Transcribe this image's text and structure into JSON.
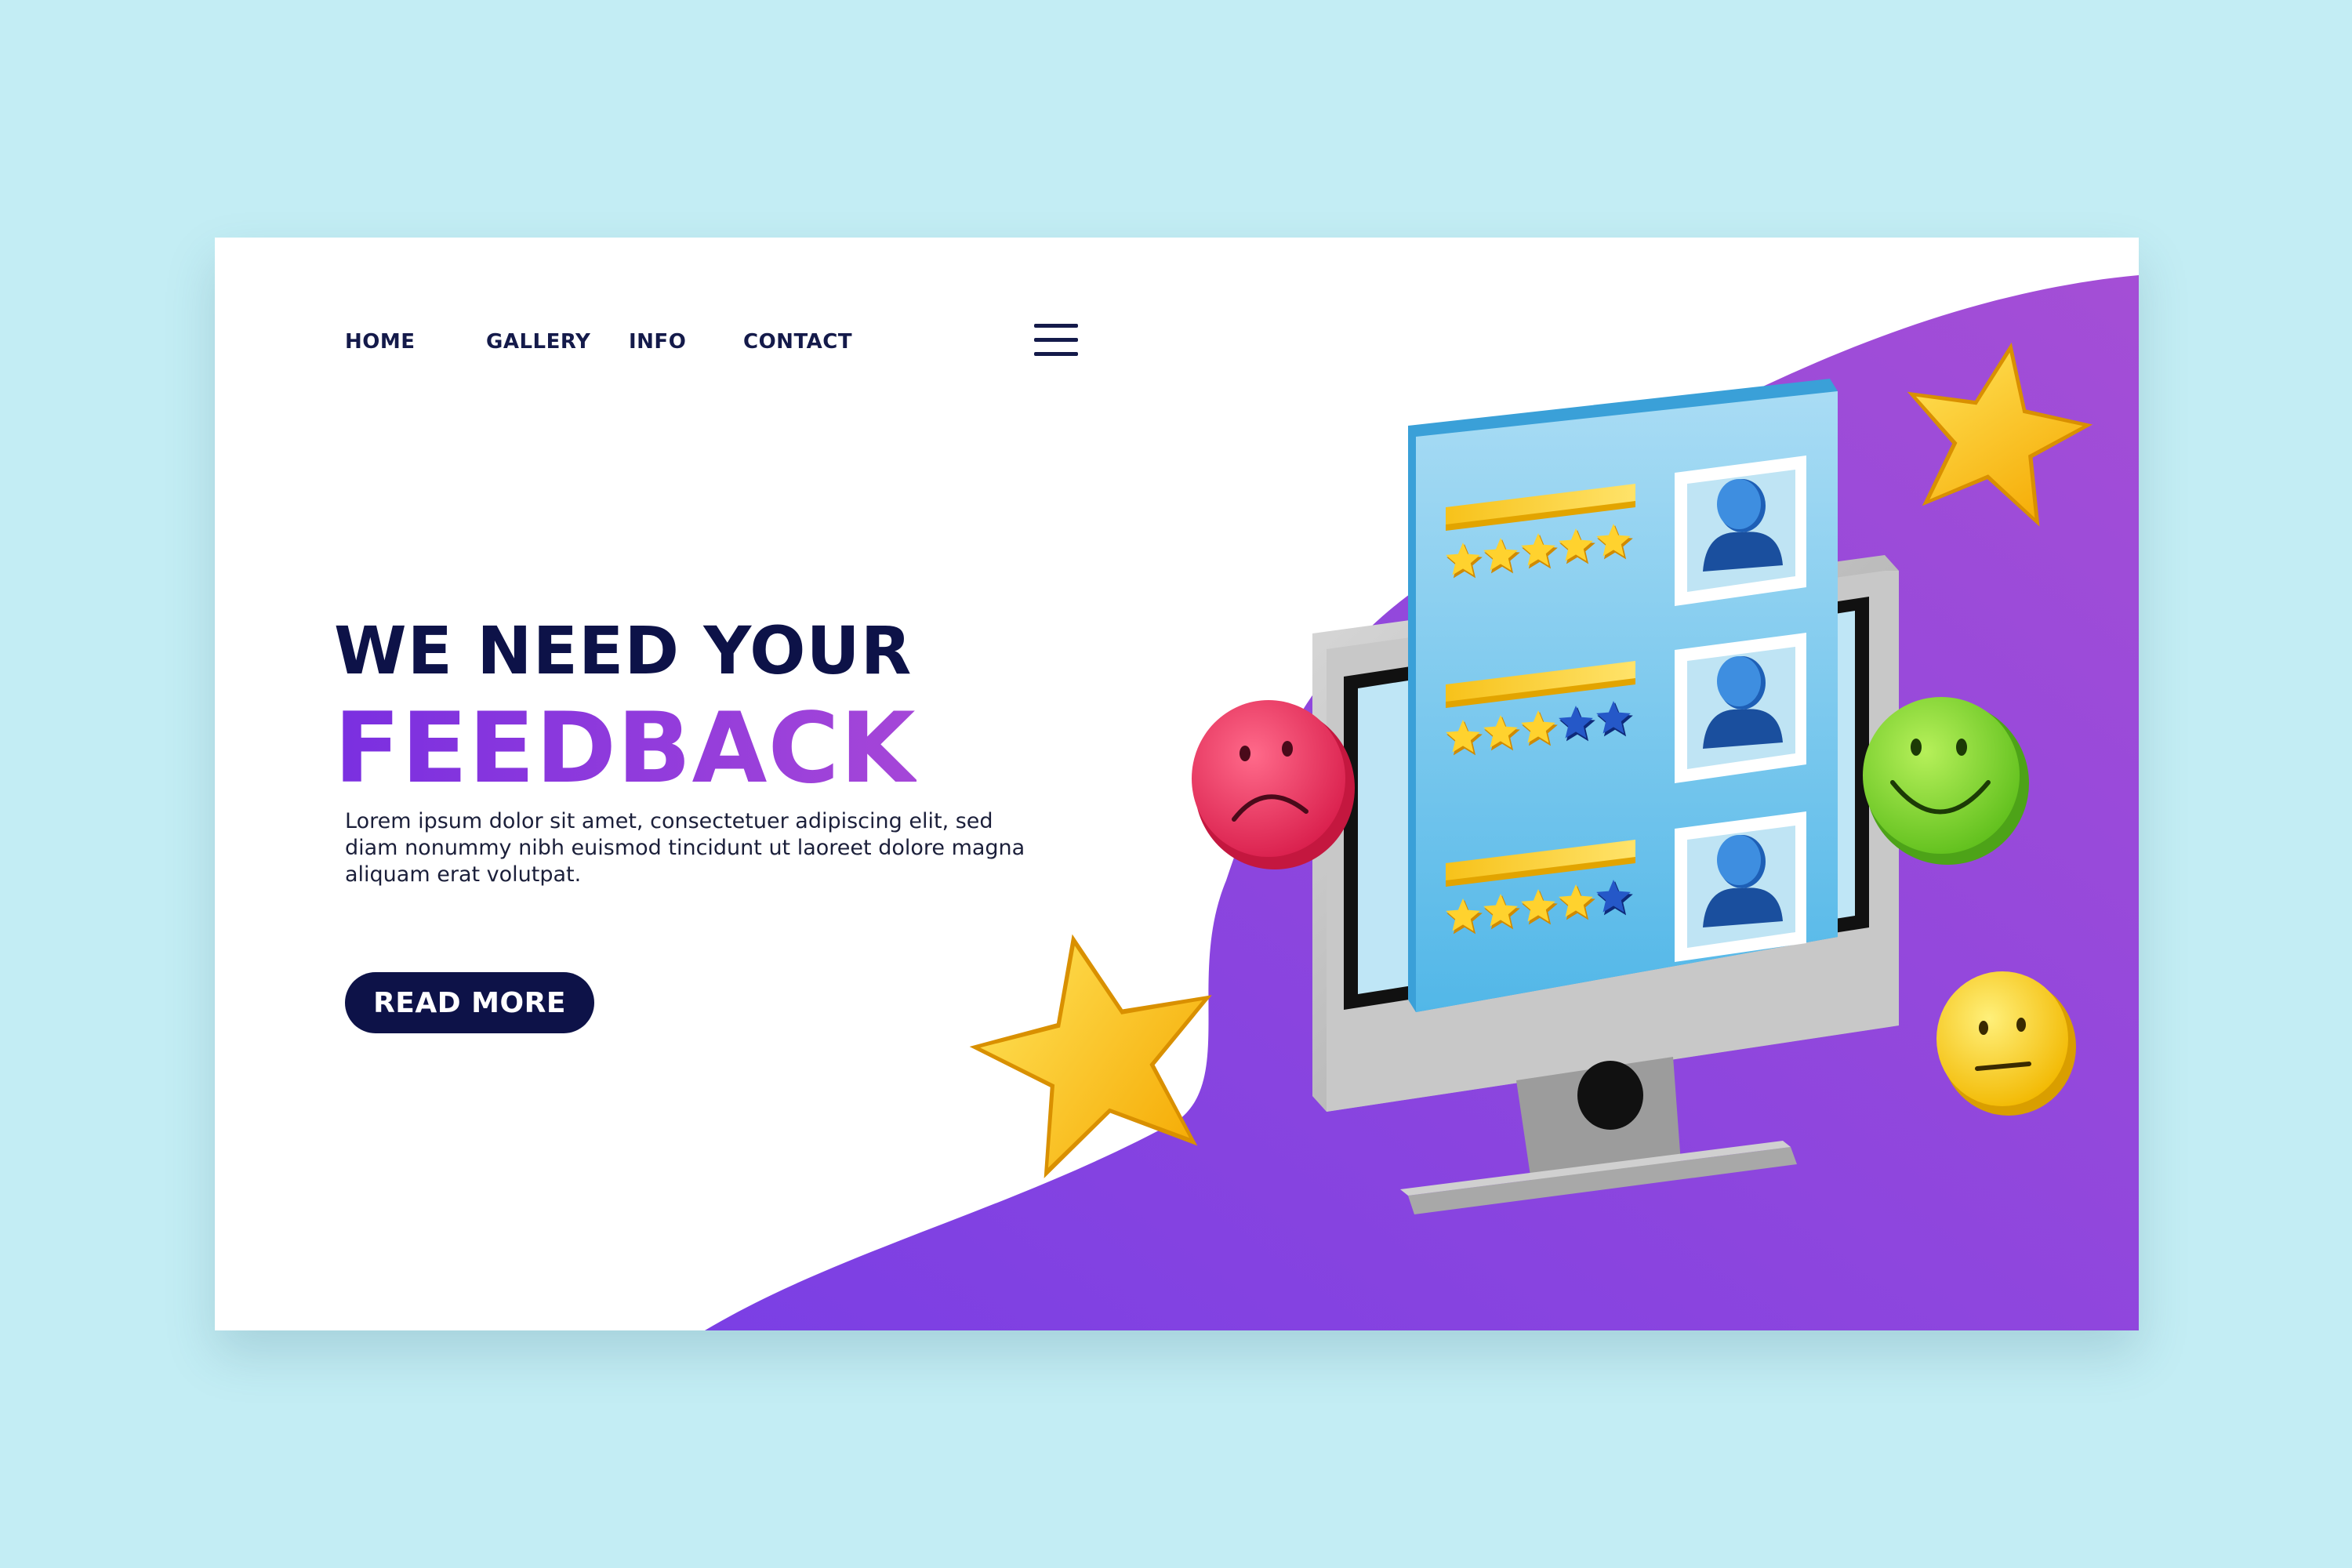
{
  "nav": {
    "items": [
      {
        "label": "HOME"
      },
      {
        "label": "GALLERY"
      },
      {
        "label": "INFO"
      },
      {
        "label": "CONTACT"
      }
    ],
    "menu_icon": "hamburger-menu-icon"
  },
  "hero": {
    "headline_line1": "WE NEED YOUR",
    "headline_line2": "FEEDBACK",
    "body": "Lorem ipsum dolor sit amet, consectetuer adipiscing elit, sed diam nonummy nibh euismod tincidunt ut laoreet dolore magna aliquam erat volutpat.",
    "cta_label": "READ MORE"
  },
  "reviews": [
    {
      "rating": 5,
      "max": 5,
      "avatar_icon": "user-avatar-icon"
    },
    {
      "rating": 3,
      "max": 5,
      "avatar_icon": "user-avatar-icon"
    },
    {
      "rating": 4,
      "max": 5,
      "avatar_icon": "user-avatar-icon"
    }
  ],
  "emojis": [
    {
      "name": "sad-face-icon",
      "color": "#e8345e"
    },
    {
      "name": "happy-face-icon",
      "color": "#7ed321"
    },
    {
      "name": "neutral-face-icon",
      "color": "#ffd21f"
    }
  ],
  "colors": {
    "page_background": "#c3edf4",
    "accent_purple": "#8b34e0",
    "navy": "#0d1248",
    "star_gold": "#ffc21a",
    "panel_blue": "#6dc3ec"
  }
}
